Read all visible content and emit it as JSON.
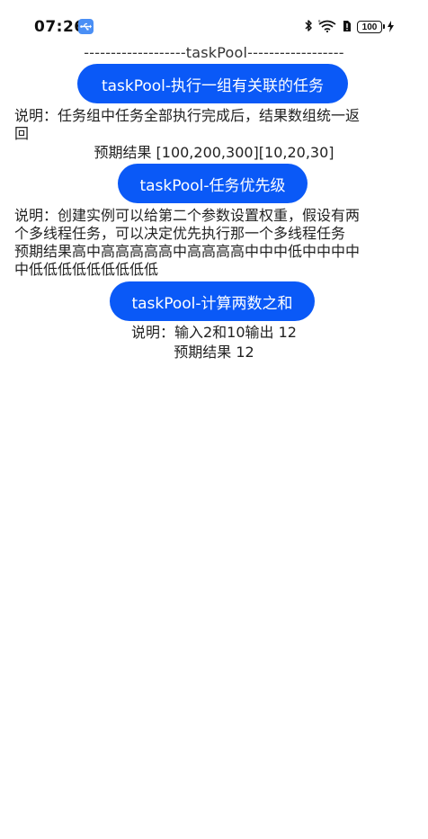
{
  "status_bar": {
    "time": "07:26",
    "battery": "100",
    "usb_icon": "usb-icon",
    "bluetooth_icon": "bluetooth-icon",
    "wifi_icon": "wifi-6-icon",
    "sim_icon": "sim-alert-icon",
    "charging_icon": "charging-bolt-icon"
  },
  "header": {
    "divider": "-------------------taskPool------------------"
  },
  "sections": [
    {
      "button_label": "taskPool-执行一组有关联的任务",
      "description_line1": "说明：任务组中任务全部执行完成后，结果数组统一返",
      "description_line2": "回",
      "expected": "预期结果 [100,200,300][10,20,30]"
    },
    {
      "button_label": "taskPool-任务优先级",
      "description_line1": "说明：创建实例可以给第二个参数设置权重，假设有两",
      "description_line2": "个多线程任务，可以决定优先执行那一个多线程任务",
      "expected_line1": "预期结果高中高高高高高中高高高高中中中低中中中中",
      "expected_line2": "中低低低低低低低低低"
    },
    {
      "button_label": "taskPool-计算两数之和",
      "description": "说明：输入2和10输出 12",
      "expected": "预期结果 12"
    }
  ],
  "colors": {
    "button_bg": "#0a59f7",
    "button_text": "#ffffff",
    "usb_badge": "#4a8ff5"
  }
}
